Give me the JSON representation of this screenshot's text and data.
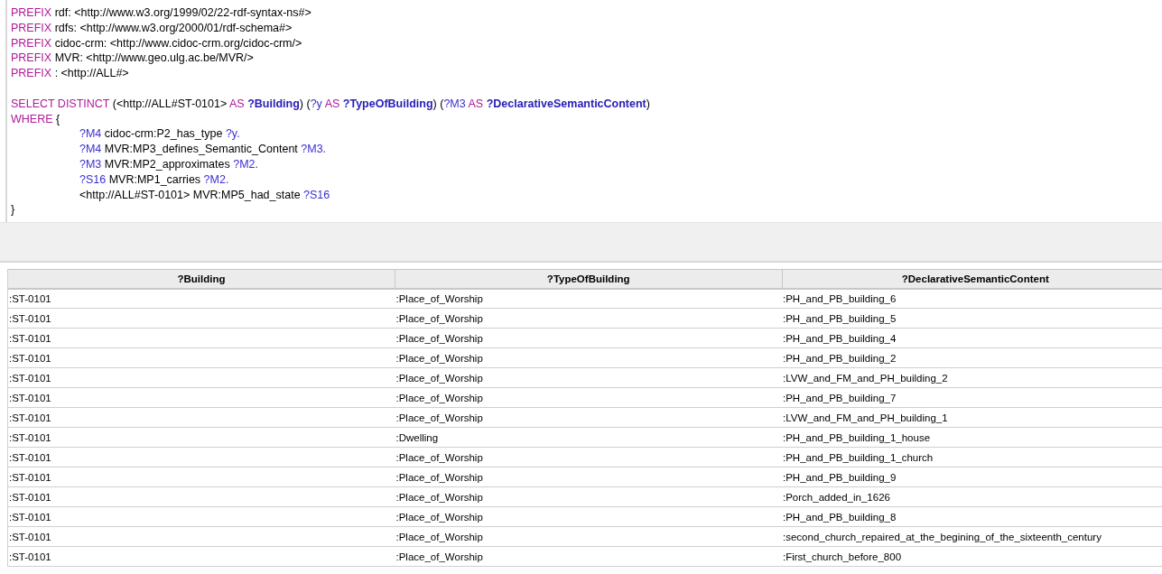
{
  "query": {
    "prefixes": [
      [
        {
          "kind": "keyword",
          "text": "PREFIX"
        },
        {
          "kind": "text",
          "text": " rdf: <http://www.w3.org/1999/02/22-rdf-syntax-ns#>"
        }
      ],
      [
        {
          "kind": "keyword",
          "text": "PREFIX"
        },
        {
          "kind": "text",
          "text": " rdfs: <http://www.w3.org/2000/01/rdf-schema#>"
        }
      ],
      [
        {
          "kind": "keyword",
          "text": "PREFIX"
        },
        {
          "kind": "text",
          "text": " cidoc-crm: <http://www.cidoc-crm.org/cidoc-crm/>"
        }
      ],
      [
        {
          "kind": "keyword",
          "text": "PREFIX"
        },
        {
          "kind": "text",
          "text": " MVR: <http://www.geo.ulg.ac.be/MVR/>"
        }
      ],
      [
        {
          "kind": "keyword",
          "text": "PREFIX"
        },
        {
          "kind": "text",
          "text": " : <http://ALL#>"
        }
      ]
    ],
    "select": [
      {
        "segments": [
          {
            "kind": "keyword",
            "text": "SELECT DISTINCT"
          },
          {
            "kind": "text",
            "text": " (<http://ALL#ST-0101> "
          },
          {
            "kind": "keyword",
            "text": "AS"
          },
          {
            "kind": "var_bold",
            "text": " ?Building"
          },
          {
            "kind": "text",
            "text": ") ("
          },
          {
            "kind": "var",
            "text": "?y "
          },
          {
            "kind": "keyword",
            "text": "AS"
          },
          {
            "kind": "var_bold",
            "text": " ?TypeOfBuilding"
          },
          {
            "kind": "text",
            "text": ") ("
          },
          {
            "kind": "var",
            "text": "?M3 "
          },
          {
            "kind": "keyword",
            "text": "AS"
          },
          {
            "kind": "var_bold",
            "text": " ?DeclarativeSemanticContent"
          },
          {
            "kind": "text",
            "text": ")"
          }
        ]
      },
      {
        "segments": [
          {
            "kind": "keyword",
            "text": "WHERE"
          },
          {
            "kind": "text",
            "text": " {"
          }
        ],
        "children": [
          {
            "segments": [
              {
                "kind": "var",
                "text": "?M4"
              },
              {
                "kind": "text",
                "text": " cidoc-crm:P2_has_type "
              },
              {
                "kind": "var",
                "text": "?y."
              }
            ]
          },
          {
            "segments": [
              {
                "kind": "var",
                "text": "?M4"
              },
              {
                "kind": "text",
                "text": " MVR:MP3_defines_Semantic_Content "
              },
              {
                "kind": "var",
                "text": "?M3."
              }
            ]
          },
          {
            "segments": [
              {
                "kind": "var",
                "text": "?M3"
              },
              {
                "kind": "text",
                "text": " MVR:MP2_approximates "
              },
              {
                "kind": "var",
                "text": "?M2."
              }
            ]
          },
          {
            "segments": [
              {
                "kind": "var",
                "text": "?S16"
              },
              {
                "kind": "text",
                "text": " MVR:MP1_carries "
              },
              {
                "kind": "var",
                "text": "?M2."
              }
            ]
          },
          {
            "segments": [
              {
                "kind": "text",
                "text": "<http://ALL#ST-0101> MVR:MP5_had_state "
              },
              {
                "kind": "var",
                "text": "?S16"
              }
            ]
          }
        ]
      },
      {
        "segments": [
          {
            "kind": "text",
            "text": "}"
          }
        ]
      }
    ]
  },
  "table": {
    "columns": [
      "?Building",
      "?TypeOfBuilding",
      "?DeclarativeSemanticContent"
    ],
    "rows": [
      [
        ":ST-0101",
        ":Place_of_Worship",
        ":PH_and_PB_building_6"
      ],
      [
        ":ST-0101",
        ":Place_of_Worship",
        ":PH_and_PB_building_5"
      ],
      [
        ":ST-0101",
        ":Place_of_Worship",
        ":PH_and_PB_building_4"
      ],
      [
        ":ST-0101",
        ":Place_of_Worship",
        ":PH_and_PB_building_2"
      ],
      [
        ":ST-0101",
        ":Place_of_Worship",
        ":LVW_and_FM_and_PH_building_2"
      ],
      [
        ":ST-0101",
        ":Place_of_Worship",
        ":PH_and_PB_building_7"
      ],
      [
        ":ST-0101",
        ":Place_of_Worship",
        ":LVW_and_FM_and_PH_building_1"
      ],
      [
        ":ST-0101",
        ":Dwelling",
        ":PH_and_PB_building_1_house"
      ],
      [
        ":ST-0101",
        ":Place_of_Worship",
        ":PH_and_PB_building_1_church"
      ],
      [
        ":ST-0101",
        ":Place_of_Worship",
        ":PH_and_PB_building_9"
      ],
      [
        ":ST-0101",
        ":Place_of_Worship",
        ":Porch_added_in_1626"
      ],
      [
        ":ST-0101",
        ":Place_of_Worship",
        ":PH_and_PB_building_8"
      ],
      [
        ":ST-0101",
        ":Place_of_Worship",
        ":second_church_repaired_at_the_begining_of_the_sixteenth_century"
      ],
      [
        ":ST-0101",
        ":Place_of_Worship",
        ":First_church_before_800"
      ]
    ]
  }
}
